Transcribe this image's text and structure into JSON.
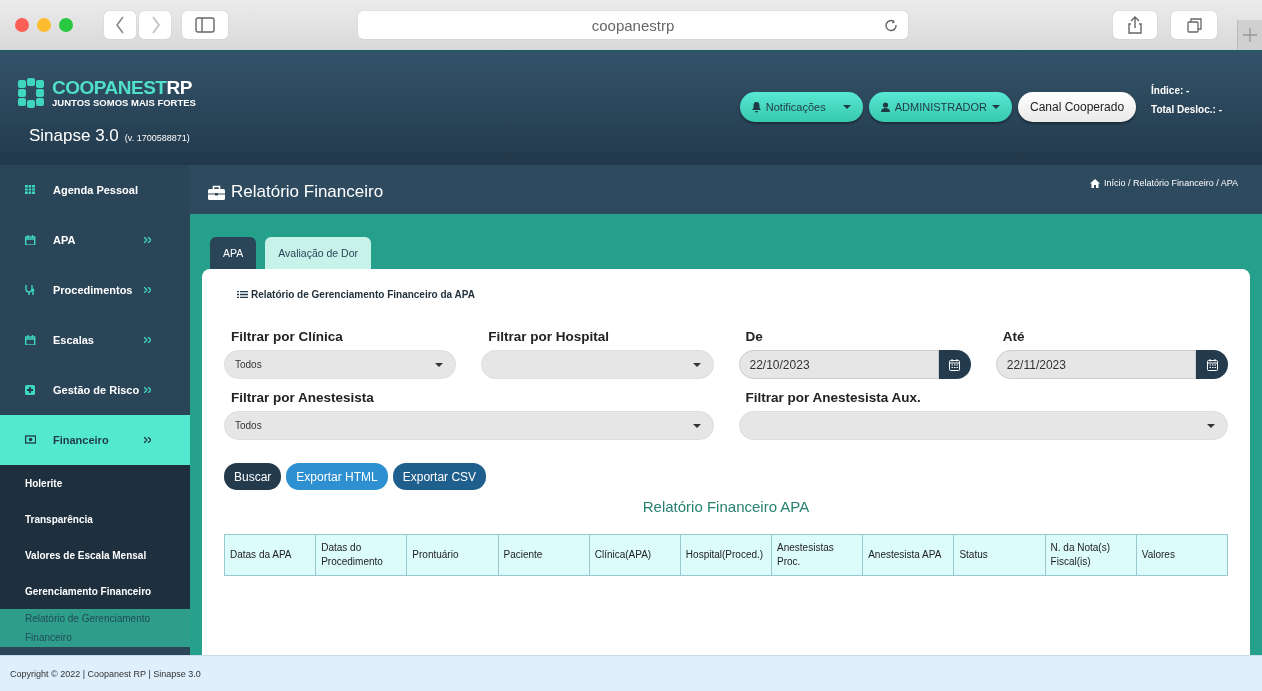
{
  "browser": {
    "address": "coopanestrp"
  },
  "header": {
    "brand": "COOPANEST",
    "brand_suffix": "RP",
    "tagline": "JUNTOS SOMOS MAIS FORTES",
    "app_name": "Sinapse 3.0",
    "version": "(v. 1700588871)",
    "buttons": [
      {
        "label": "Notificações",
        "kind": "notifications"
      },
      {
        "label": "ADMINISTRADOR",
        "kind": "user"
      },
      {
        "label": "Canal Cooperado",
        "kind": "plain"
      }
    ],
    "info": [
      "Índice: -",
      "Total Desloc.: -"
    ]
  },
  "sidebar": {
    "items": [
      {
        "label": "Agenda Pessoal",
        "selected": false,
        "kind": "link"
      },
      {
        "label": "APA",
        "selected": false,
        "kind": "menu"
      },
      {
        "label": "Procedimentos",
        "selected": false,
        "kind": "menu"
      },
      {
        "label": "Escalas",
        "selected": false,
        "kind": "menu"
      },
      {
        "label": "Gestão de Risco",
        "selected": false,
        "kind": "menu"
      },
      {
        "label": "Financeiro",
        "selected": true,
        "kind": "menu",
        "children": [
          {
            "label": "Holerite",
            "selected": false
          },
          {
            "label": "Transparência",
            "selected": false
          },
          {
            "label": "Valores de Escala Mensal",
            "selected": false
          },
          {
            "label": "Gerenciamento Financeiro",
            "selected": false
          },
          {
            "label": "Relatório de Gerenciamento Financeiro",
            "selected": true
          }
        ]
      }
    ]
  },
  "page": {
    "title": "Relatório Financeiro",
    "breadcrumb": "Início / Relatório Financeiro / APA",
    "tabs": [
      {
        "label": "APA",
        "selected": true
      },
      {
        "label": "Avaliação de Dor",
        "selected": false
      }
    ],
    "section_title": "Relatório de Gerenciamento Financeiro da APA",
    "filter_rows": [
      [
        {
          "kind": "select",
          "label": "Filtrar por Clínica",
          "value": "Todos"
        },
        {
          "kind": "select",
          "label": "Filtrar por Hospital"
        },
        {
          "kind": "date",
          "label": "De",
          "value": "22/10/2023"
        },
        {
          "kind": "date",
          "label": "Até",
          "value": "22/11/2023"
        }
      ],
      [
        {
          "kind": "select",
          "label": "Filtrar por Anestesista",
          "value": "Todos"
        },
        {
          "kind": "select",
          "label": "Filtrar por Anestesista Aux."
        }
      ]
    ],
    "buttons": [
      {
        "label": "Buscar",
        "kind": "dark"
      },
      {
        "label": "Exportar HTML",
        "kind": "light"
      },
      {
        "label": "Exportar CSV",
        "kind": "mid"
      }
    ],
    "report_title": "Relatório Financeiro APA",
    "table": {
      "columns": [
        "Datas da APA",
        "Datas do Procedimento",
        "Prontuário",
        "Paciente",
        "Clínica(APA)",
        "Hospital(Proced.)",
        "Anestesistas Proc.",
        "Anestesista APA",
        "Status",
        "N. da Nota(s) Fiscal(is)",
        "Valores"
      ]
    }
  },
  "footer": {
    "copyright": "Copyright © 2022 | Coopanest RP | Sinapse 3.0"
  }
}
